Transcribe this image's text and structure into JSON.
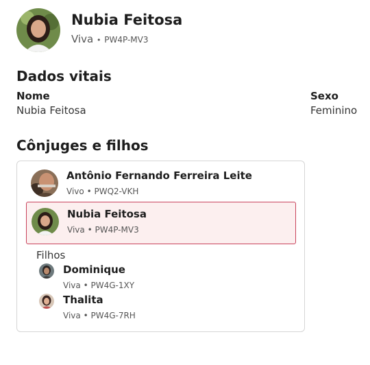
{
  "profile": {
    "name": "Nubia Feitosa",
    "status": "Viva",
    "separator": "•",
    "pid": "PW4P-MV3"
  },
  "vital": {
    "title": "Dados vitais",
    "name_label": "Nome",
    "name_value": "Nubia Feitosa",
    "sex_label": "Sexo",
    "sex_value": "Feminino"
  },
  "family": {
    "title": "Cônjuges e filhos",
    "spouse": {
      "name": "Antônio Fernando Ferreira Leite",
      "status": "Vivo",
      "pid": "PWQ2-VKH"
    },
    "self": {
      "name": "Nubia Feitosa",
      "status": "Viva",
      "pid": "PW4P-MV3"
    },
    "children_label": "Filhos",
    "children": [
      {
        "name": "Dominique",
        "status": "Viva",
        "pid": "PW4G-1XY"
      },
      {
        "name": "Thalita",
        "status": "Viva",
        "pid": "PW4G-7RH"
      }
    ]
  },
  "colors": {
    "selected_border": "#c8405a",
    "selected_bg": "#fcefef",
    "card_border": "#d5d5d5"
  }
}
